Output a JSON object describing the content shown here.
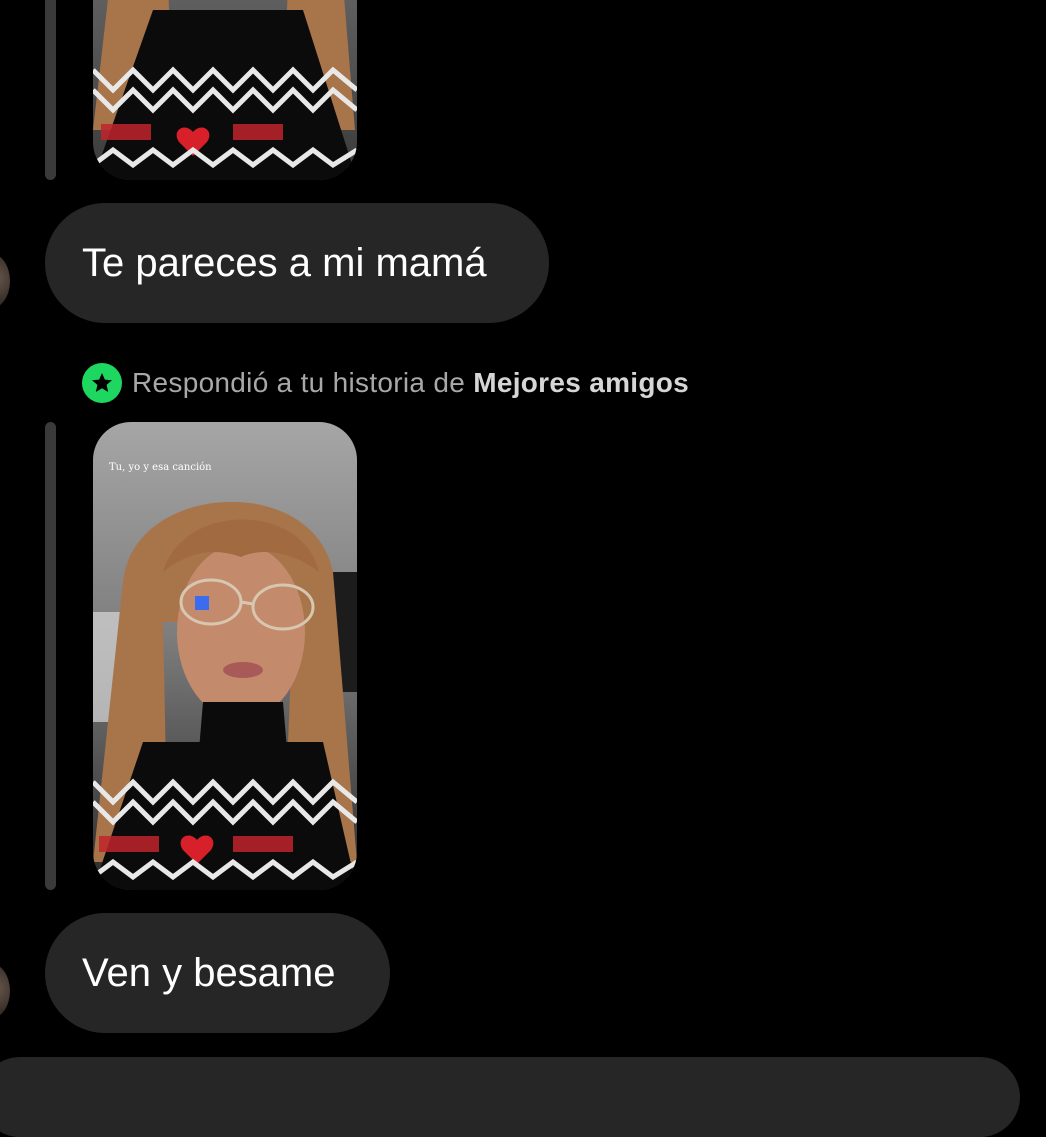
{
  "thread": {
    "messages": [
      {
        "text": "Te pareces a mi mamá"
      },
      {
        "text": "Ven y besame"
      }
    ],
    "story_reply": {
      "prefix": "Respondió a tu historia de ",
      "list_name": "Mejores amigos",
      "story_caption": "Tu, yo y esa canción"
    }
  },
  "icons": {
    "badge": "star-icon",
    "accent_color": "#1ed760"
  }
}
